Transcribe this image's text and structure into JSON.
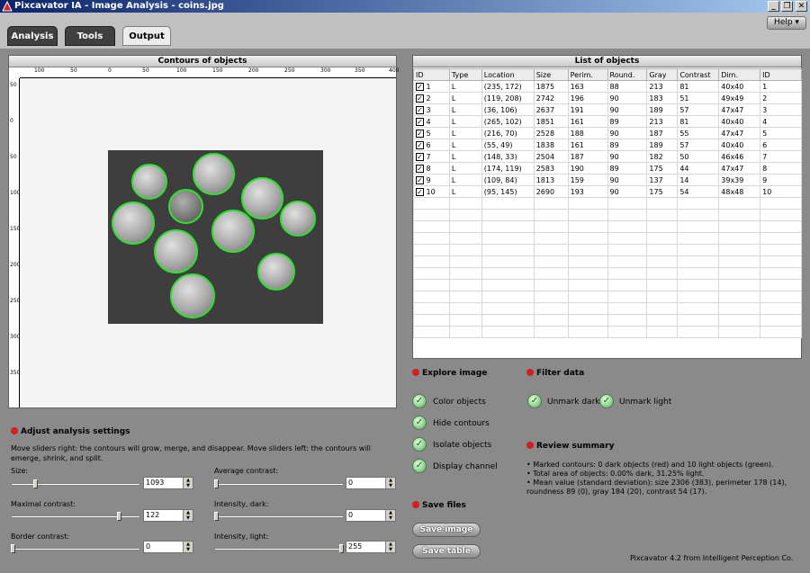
{
  "window": {
    "title": "Pixcavator IA - Image Analysis - coins.jpg",
    "minimize": "_",
    "restore": "❐",
    "close": "✕"
  },
  "tabs": [
    {
      "label": "Analysis",
      "active": false
    },
    {
      "label": "Tools",
      "active": false
    },
    {
      "label": "Output",
      "active": true
    }
  ],
  "help": {
    "label": "Help ▾"
  },
  "contours": {
    "title": "Contours of objects",
    "hticks": [
      "100",
      "50",
      "0",
      "50",
      "100",
      "150",
      "200",
      "250",
      "300",
      "350",
      "400"
    ],
    "vticks": [
      "50",
      "0",
      "50",
      "100",
      "150",
      "200",
      "250",
      "300",
      "350"
    ]
  },
  "objects": {
    "title": "List of objects",
    "columns": [
      "ID",
      "Type",
      "Location",
      "Size",
      "Perim.",
      "Round.",
      "Gray",
      "Contrast",
      "Dim.",
      "ID"
    ],
    "rows": [
      [
        "1",
        "L",
        "(235, 172)",
        "1875",
        "163",
        "88",
        "213",
        "81",
        "40x40",
        "1"
      ],
      [
        "2",
        "L",
        "(119, 208)",
        "2742",
        "196",
        "90",
        "183",
        "51",
        "49x49",
        "2"
      ],
      [
        "3",
        "L",
        "(36, 106)",
        "2637",
        "191",
        "90",
        "189",
        "57",
        "47x47",
        "3"
      ],
      [
        "4",
        "L",
        "(265, 102)",
        "1851",
        "161",
        "89",
        "213",
        "81",
        "40x40",
        "4"
      ],
      [
        "5",
        "L",
        "(216, 70)",
        "2528",
        "188",
        "90",
        "187",
        "55",
        "47x47",
        "5"
      ],
      [
        "6",
        "L",
        "(55, 49)",
        "1838",
        "161",
        "89",
        "189",
        "57",
        "40x40",
        "6"
      ],
      [
        "7",
        "L",
        "(148, 33)",
        "2504",
        "187",
        "90",
        "182",
        "50",
        "46x46",
        "7"
      ],
      [
        "8",
        "L",
        "(174, 119)",
        "2583",
        "190",
        "89",
        "175",
        "44",
        "47x47",
        "8"
      ],
      [
        "9",
        "L",
        "(109, 84)",
        "1813",
        "159",
        "90",
        "137",
        "14",
        "39x39",
        "9"
      ],
      [
        "10",
        "L",
        "(95, 145)",
        "2690",
        "193",
        "90",
        "175",
        "54",
        "48x48",
        "10"
      ]
    ],
    "checked_mark": "✓"
  },
  "explore": {
    "title": "Explore image",
    "options": [
      "Color objects",
      "Hide contours",
      "Isolate objects",
      "Display channel"
    ]
  },
  "filter": {
    "title": "Filter data",
    "options": [
      "Unmark dark",
      "Unmark light"
    ]
  },
  "review": {
    "title": "Review summary",
    "lines": [
      "• Marked contours: 0 dark objects (red) and 10 light objects (green).",
      "• Total area of objects: 0.00% dark, 31.25% light.",
      "• Mean value (standard deviation): size 2306 (383), perimeter 178 (14), roundness 89 (0), gray 184 (20), contrast 54 (17)."
    ]
  },
  "savefiles": {
    "title": "Save files",
    "save_image": "Save image",
    "save_table": "Save table"
  },
  "settings": {
    "title": "Adjust analysis settings",
    "description": "Move sliders right: the contours will grow, merge, and disappear. Move sliders left: the contours will emerge, shrink, and split.",
    "size": {
      "label": "Size:",
      "value": "1093",
      "level": 0.18
    },
    "avg_contrast": {
      "label": "Average contrast:",
      "value": "0",
      "level": 0.0
    },
    "max_contrast": {
      "label": "Maximal contrast:",
      "value": "122",
      "level": 0.85
    },
    "int_dark": {
      "label": "Intensity, dark:",
      "value": "0",
      "level": 0.0
    },
    "border_contrast": {
      "label": "Border contrast:",
      "value": "0",
      "level": 0.0
    },
    "int_light": {
      "label": "Intensity, light:",
      "value": "255",
      "level": 1.0
    }
  },
  "footer": "Pixcavator 4.2 from Intelligent Perception Co.",
  "colors": {
    "contour": "#2ee22e",
    "accent_red": "#d02020"
  }
}
